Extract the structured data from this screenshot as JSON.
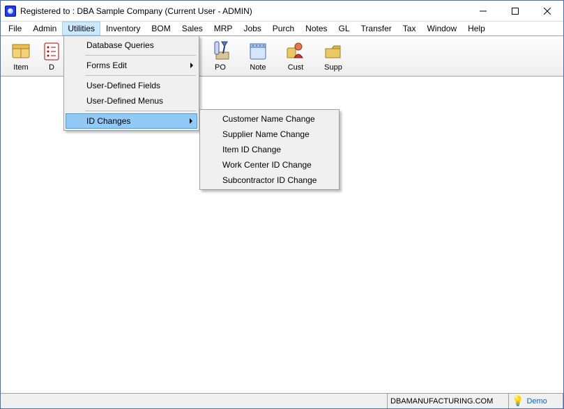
{
  "window": {
    "title": "Registered to : DBA Sample Company (Current User - ADMIN)"
  },
  "menubar": {
    "items": [
      "File",
      "Admin",
      "Utilities",
      "Inventory",
      "BOM",
      "Sales",
      "MRP",
      "Jobs",
      "Purch",
      "Notes",
      "GL",
      "Transfer",
      "Tax",
      "Window",
      "Help"
    ],
    "active_index": 2
  },
  "toolbar": {
    "buttons": [
      {
        "label": "Item",
        "icon": "item-icon"
      },
      {
        "label": "D",
        "icon": "list-icon"
      },
      {
        "label": "",
        "icon": "hidden-icon"
      },
      {
        "label": "",
        "icon": "hidden-icon"
      },
      {
        "label": "",
        "icon": "hidden-icon"
      },
      {
        "label": "PO",
        "icon": "po-icon"
      },
      {
        "label": "Note",
        "icon": "note-icon"
      },
      {
        "label": "Cust",
        "icon": "cust-icon"
      },
      {
        "label": "Supp",
        "icon": "supp-icon"
      }
    ]
  },
  "dropdown": {
    "utilities": {
      "items": [
        {
          "label": "Database Queries",
          "has_submenu": false
        },
        {
          "label": "Forms Edit",
          "has_submenu": true
        },
        {
          "label": "User-Defined Fields",
          "has_submenu": false
        },
        {
          "label": "User-Defined Menus",
          "has_submenu": false
        },
        {
          "label": "ID Changes",
          "has_submenu": true,
          "highlight": true
        }
      ]
    },
    "id_changes": {
      "items": [
        {
          "label": "Customer Name Change"
        },
        {
          "label": "Supplier Name Change"
        },
        {
          "label": "Item ID Change"
        },
        {
          "label": "Work Center ID Change"
        },
        {
          "label": "Subcontractor ID Change"
        }
      ]
    }
  },
  "statusbar": {
    "url": "DBAMANUFACTURING.COM",
    "demo": "Demo"
  }
}
